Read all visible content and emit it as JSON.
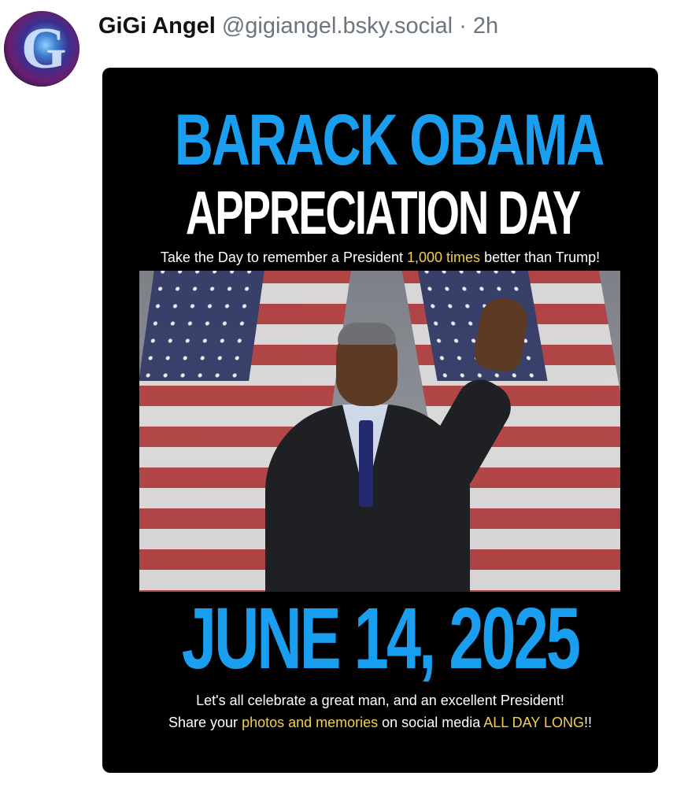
{
  "post": {
    "author_name": "GiGi Angel",
    "author_handle": "@gigiangel.bsky.social",
    "separator": "·",
    "timestamp": "2h",
    "avatar_icon": "avatar-image"
  },
  "flyer": {
    "title_line1": "BARACK OBAMA",
    "title_line2": "APPRECIATION DAY",
    "tagline": {
      "before": "Take the Day to remember a President ",
      "highlight": "1,000 times",
      "after": " better than Trump!"
    },
    "date": "JUNE 14, 2025",
    "footer_line1": "Let's all celebrate a great man, and an excellent President!",
    "footer_line2": {
      "part1": "Share your ",
      "highlight1": "photos and memories",
      "part2": " on social media ",
      "highlight2": "ALL DAY LONG",
      "part3": "!!"
    }
  },
  "colors": {
    "title_blue": "#1a9ff0",
    "highlight_yellow": "#f3d04a",
    "flyer_background": "#000000",
    "handle_gray": "#6b7580"
  }
}
